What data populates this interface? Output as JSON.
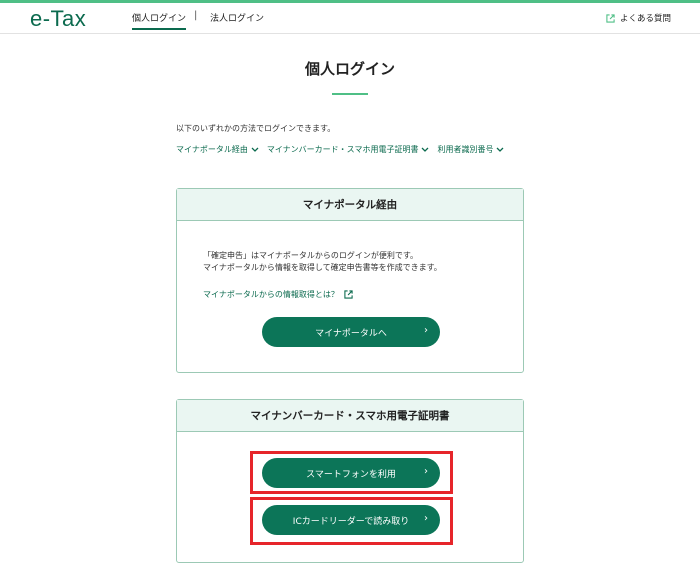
{
  "header": {
    "logo": "e-Tax",
    "nav_personal": "個人ログイン",
    "nav_separator": "|",
    "nav_corporate": "法人ログイン",
    "faq": "よくある質問"
  },
  "page": {
    "title": "個人ログイン",
    "intro": "以下のいずれかの方法でログインできます。",
    "method_links": [
      "マイナポータル経由",
      "マイナンバーカード・スマホ用電子証明書",
      "利用者識別番号"
    ]
  },
  "card_portal": {
    "title": "マイナポータル経由",
    "desc_line1": "「確定申告」はマイナポータルからのログインが便利です。",
    "desc_line2": "マイナポータルから情報を取得して確定申告書等を作成できます。",
    "info_link": "マイナポータルからの情報取得とは？",
    "button": "マイナポータルへ"
  },
  "card_cert": {
    "title": "マイナンバーカード・スマホ用電子証明書",
    "button_smartphone": "スマートフォンを利用",
    "button_icreader": "ICカードリーダーで読み取り"
  },
  "colors": {
    "brand": "#0b6a4e",
    "button": "#0c7558",
    "accent": "#4fbf86",
    "highlight": "#e6252a",
    "card_header": "#eaf6f2"
  },
  "icons": {
    "external": "external-link-icon",
    "chevron": "chevron-down-icon",
    "arrow": "chevron-right-icon"
  }
}
